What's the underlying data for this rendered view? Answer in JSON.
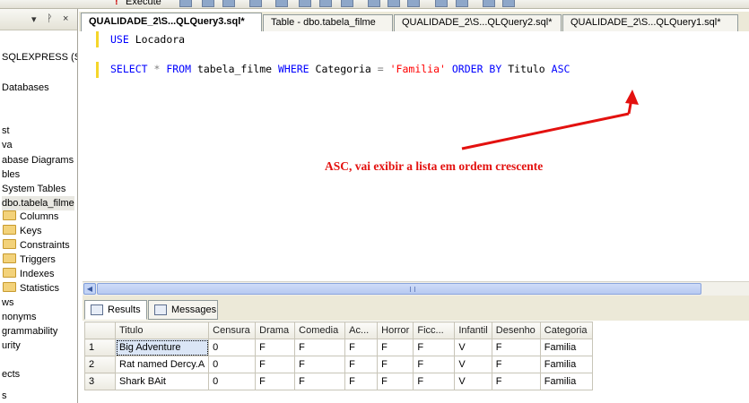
{
  "toolbar": {
    "execute_label": "Execute"
  },
  "explorer": {
    "header_pin": "▾",
    "header_close": "×",
    "items": [
      {
        "label": "SQLEXPRESS (SQ",
        "folder": false
      },
      {
        "label": "Databases",
        "folder": false
      },
      {
        "label": "st",
        "folder": false
      },
      {
        "label": "va",
        "folder": false
      },
      {
        "label": "abase Diagrams",
        "folder": false
      },
      {
        "label": "bles",
        "folder": false
      },
      {
        "label": "System Tables",
        "folder": false
      },
      {
        "label": "dbo.tabela_filme",
        "folder": false
      },
      {
        "label": "Columns",
        "folder": true
      },
      {
        "label": "Keys",
        "folder": true
      },
      {
        "label": "Constraints",
        "folder": true
      },
      {
        "label": "Triggers",
        "folder": true
      },
      {
        "label": "Indexes",
        "folder": true
      },
      {
        "label": "Statistics",
        "folder": true
      },
      {
        "label": "ws",
        "folder": false
      },
      {
        "label": "nonyms",
        "folder": false
      },
      {
        "label": "grammability",
        "folder": false
      },
      {
        "label": "urity",
        "folder": false
      },
      {
        "label": "ects",
        "folder": false
      },
      {
        "label": "s",
        "folder": false
      }
    ]
  },
  "tabs": [
    "QUALIDADE_2\\S...QLQuery3.sql*",
    "Table - dbo.tabela_filme",
    "QUALIDADE_2\\S...QLQuery2.sql*",
    "QUALIDADE_2\\S...QLQuery1.sql*"
  ],
  "editor": {
    "line1": {
      "kw": "USE",
      "rest": " Locadora"
    },
    "line2": {
      "select": "SELECT",
      "star": " * ",
      "from": "FROM",
      "table": " tabela_filme ",
      "where": "WHERE",
      "col": " Categoria ",
      "eq": "=",
      "str": " 'Familia'",
      "orderby": " ORDER BY",
      "col2": " Titulo ",
      "asc": "ASC"
    },
    "annotation": "ASC, vai exibir a lista em ordem crescente"
  },
  "result_tabs": [
    "Results",
    "Messages"
  ],
  "grid": {
    "columns": [
      "Titulo",
      "Censura",
      "Drama",
      "Comedia",
      "Ac...",
      "Horror",
      "Ficc...",
      "Infantil",
      "Desenho",
      "Categoria"
    ],
    "rows": [
      [
        "1",
        "Big Adventure",
        "0",
        "F",
        "F",
        "F",
        "F",
        "F",
        "V",
        "F",
        "Familia"
      ],
      [
        "2",
        "Rat named Dercy.A",
        "0",
        "F",
        "F",
        "F",
        "F",
        "F",
        "V",
        "F",
        "Familia"
      ],
      [
        "3",
        "Shark BAit",
        "0",
        "F",
        "F",
        "F",
        "F",
        "F",
        "V",
        "F",
        "Familia"
      ]
    ]
  },
  "colors": {
    "annotation": "#e3110f",
    "keyword": "#0000ff",
    "string": "#ff0000"
  }
}
